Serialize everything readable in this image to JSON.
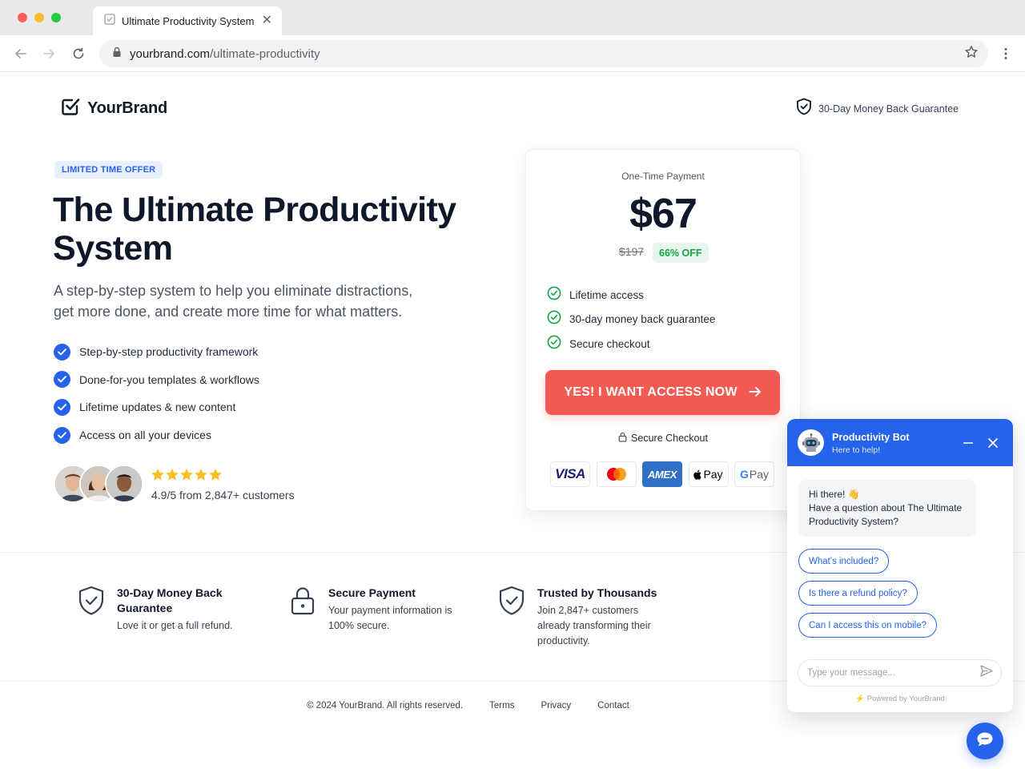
{
  "browser": {
    "tab_title": "Ultimate Productivity System",
    "url_host": "yourbrand.com",
    "url_path": "/ultimate-productivity",
    "traffic_colors": [
      "#ff5f57",
      "#febc2e",
      "#28c840"
    ]
  },
  "header": {
    "brand": "YourBrand",
    "guarantee": "30-Day Money Back Guarantee"
  },
  "hero": {
    "badge": "LIMITED TIME OFFER",
    "headline": "The Ultimate Productivity System",
    "subhead": "A step-by-step system to help you eliminate distractions, get more done, and create more time for what matters.",
    "features": [
      "Step-by-step productivity framework",
      "Done-for-you templates & workflows",
      "Lifetime updates & new content",
      "Access on all your devices"
    ],
    "stars": 5,
    "rating_text": "4.9/5 from 2,847+ customers"
  },
  "pricing": {
    "label": "One-Time Payment",
    "price": "$67",
    "old_price": "$197",
    "discount": "66% OFF",
    "features": [
      "Lifetime access",
      "30-day money back guarantee",
      "Secure checkout"
    ],
    "cta": "YES! I WANT ACCESS NOW",
    "secure": "Secure Checkout",
    "payment_methods": [
      "VISA",
      "Mastercard",
      "AMEX",
      "Pay",
      "Pay"
    ]
  },
  "trust": [
    {
      "title": "30-Day Money Back Guarantee",
      "desc": "Love it or get a full refund."
    },
    {
      "title": "Secure Payment",
      "desc": "Your payment information is 100% secure."
    },
    {
      "title": "Trusted by Thousands",
      "desc": "Join 2,847+ customers already transforming their productivity."
    }
  ],
  "footer": {
    "copyright": "© 2024 YourBrand. All rights reserved.",
    "links": [
      "Terms",
      "Privacy",
      "Contact"
    ]
  },
  "chat": {
    "bot_name": "Productivity Bot",
    "bot_status": "Here to help!",
    "greeting": "Hi there! 👋",
    "message": "Have a question about The Ultimate Productivity System?",
    "quick_replies": [
      "What's included?",
      "Is there a refund policy?",
      "Can I access this on mobile?"
    ],
    "input_placeholder": "Type your message...",
    "powered_by": "Powered by YourBrand"
  },
  "colors": {
    "primary": "#2563eb",
    "cta": "#f25a52",
    "success": "#16a34a",
    "star": "#fbbf24"
  }
}
